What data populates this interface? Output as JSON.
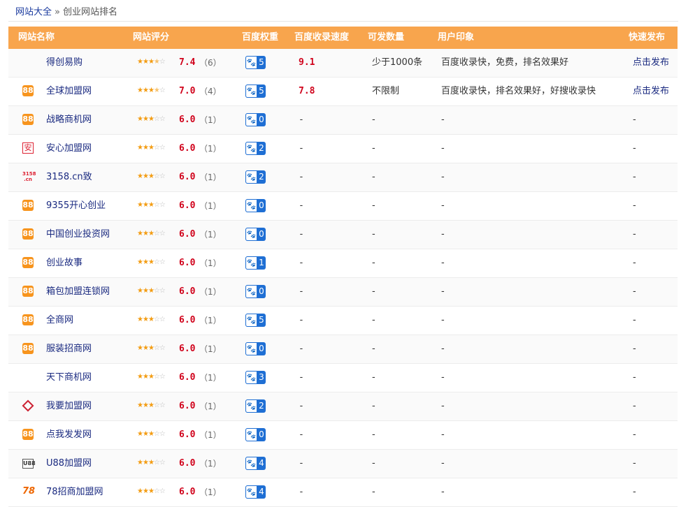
{
  "breadcrumb": {
    "home": "网站大全",
    "sep": "»",
    "current": "创业网站排名"
  },
  "columns": {
    "name": "网站名称",
    "rating": "网站评分",
    "weight": "百度权重",
    "speed": "百度收录速度",
    "amount": "可发数量",
    "impression": "用户印象",
    "publish": "快速发布"
  },
  "stars_full": "★",
  "stars_empty": "☆",
  "rows": [
    {
      "logo": "none",
      "name": "得创易购",
      "stars": 3.5,
      "score": "7.4",
      "count": "（6）",
      "weight": "5",
      "speed": "9.1",
      "amount": "少于1000条",
      "impression": "百度收录快，免费，排名效果好",
      "publish": "点击发布"
    },
    {
      "logo": "b88",
      "logo_text": "88",
      "name": "全球加盟网",
      "stars": 3.5,
      "score": "7.0",
      "count": "（4）",
      "weight": "5",
      "speed": "7.8",
      "amount": "不限制",
      "impression": "百度收录快，排名效果好，好搜收录快",
      "publish": "点击发布"
    },
    {
      "logo": "b88",
      "logo_text": "88",
      "name": "战略商机网",
      "stars": 3,
      "score": "6.0",
      "count": "（1）",
      "weight": "0",
      "speed": "-",
      "amount": "-",
      "impression": "-",
      "publish": "-"
    },
    {
      "logo": "an",
      "logo_text": "安",
      "name": "安心加盟网",
      "stars": 3,
      "score": "6.0",
      "count": "（1）",
      "weight": "2",
      "speed": "-",
      "amount": "-",
      "impression": "-",
      "publish": "-"
    },
    {
      "logo": "t3158",
      "logo_text": "3158 .cn",
      "name": "3158.cn致",
      "stars": 3,
      "score": "6.0",
      "count": "（1）",
      "weight": "2",
      "speed": "-",
      "amount": "-",
      "impression": "-",
      "publish": "-"
    },
    {
      "logo": "b88",
      "logo_text": "88",
      "name": "9355开心创业",
      "stars": 3,
      "score": "6.0",
      "count": "（1）",
      "weight": "0",
      "speed": "-",
      "amount": "-",
      "impression": "-",
      "publish": "-"
    },
    {
      "logo": "b88",
      "logo_text": "88",
      "name": "中国创业投资网",
      "stars": 3,
      "score": "6.0",
      "count": "（1）",
      "weight": "0",
      "speed": "-",
      "amount": "-",
      "impression": "-",
      "publish": "-"
    },
    {
      "logo": "b88",
      "logo_text": "88",
      "name": "创业故事",
      "stars": 3,
      "score": "6.0",
      "count": "（1）",
      "weight": "1",
      "speed": "-",
      "amount": "-",
      "impression": "-",
      "publish": "-"
    },
    {
      "logo": "b88",
      "logo_text": "88",
      "name": "箱包加盟连锁网",
      "stars": 3,
      "score": "6.0",
      "count": "（1）",
      "weight": "0",
      "speed": "-",
      "amount": "-",
      "impression": "-",
      "publish": "-"
    },
    {
      "logo": "b88",
      "logo_text": "88",
      "name": "全商网",
      "stars": 3,
      "score": "6.0",
      "count": "（1）",
      "weight": "5",
      "speed": "-",
      "amount": "-",
      "impression": "-",
      "publish": "-"
    },
    {
      "logo": "b88",
      "logo_text": "88",
      "name": "服装招商网",
      "stars": 3,
      "score": "6.0",
      "count": "（1）",
      "weight": "0",
      "speed": "-",
      "amount": "-",
      "impression": "-",
      "publish": "-"
    },
    {
      "logo": "none",
      "name": "天下商机网",
      "stars": 3,
      "score": "6.0",
      "count": "（1）",
      "weight": "3",
      "speed": "-",
      "amount": "-",
      "impression": "-",
      "publish": "-"
    },
    {
      "logo": "diamond",
      "name": "我要加盟网",
      "stars": 3,
      "score": "6.0",
      "count": "（1）",
      "weight": "2",
      "speed": "-",
      "amount": "-",
      "impression": "-",
      "publish": "-"
    },
    {
      "logo": "b88",
      "logo_text": "88",
      "name": "点我发发网",
      "stars": 3,
      "score": "6.0",
      "count": "（1）",
      "weight": "0",
      "speed": "-",
      "amount": "-",
      "impression": "-",
      "publish": "-"
    },
    {
      "logo": "u88",
      "logo_text": "U88",
      "name": "U88加盟网",
      "stars": 3,
      "score": "6.0",
      "count": "（1）",
      "weight": "4",
      "speed": "-",
      "amount": "-",
      "impression": "-",
      "publish": "-"
    },
    {
      "logo": "s78",
      "logo_text": "78",
      "name": "78招商加盟网",
      "stars": 3,
      "score": "6.0",
      "count": "（1）",
      "weight": "4",
      "speed": "-",
      "amount": "-",
      "impression": "-",
      "publish": "-"
    }
  ],
  "colors": {
    "header_bg": "#f8a54d",
    "score_red": "#d0021b",
    "link_blue": "#1a2a80",
    "badge_blue": "#1f6fd4",
    "star": "#f39c12"
  },
  "icons": {
    "badge": "paw-icon",
    "rating": "star-icon"
  }
}
